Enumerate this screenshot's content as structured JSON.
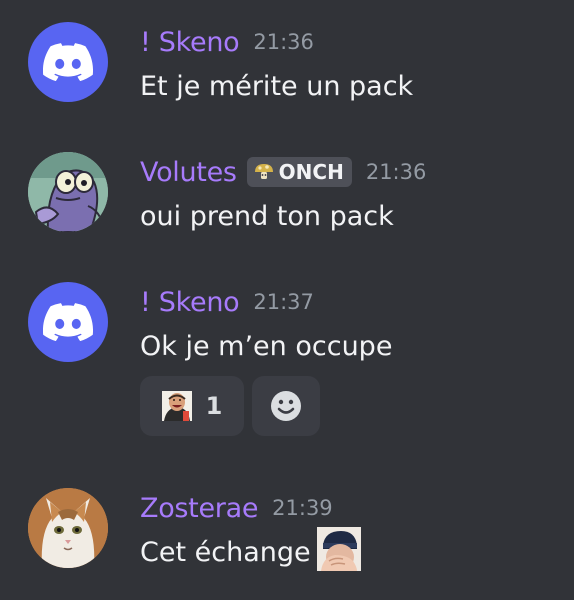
{
  "messages": [
    {
      "username": "! Skeno",
      "timestamp": "21:36",
      "content": "Et je mérite un pack",
      "avatar": "discord-default-avatar"
    },
    {
      "username": "Volutes",
      "tag": "ONCH",
      "timestamp": "21:36",
      "content": "oui prend ton pack",
      "avatar": "cartoon-fish-avatar"
    },
    {
      "username": "! Skeno",
      "timestamp": "21:37",
      "content": "Ok je m’en occupe",
      "avatar": "discord-default-avatar",
      "reactions": [
        {
          "emoji": "laughing-man-emoji",
          "count": "1"
        },
        {
          "emoji": "add-reaction-smiley-icon"
        }
      ]
    },
    {
      "username": "Zosterae",
      "timestamp": "21:39",
      "content": "Cet échange",
      "avatar": "kitten-avatar",
      "inline_emoji": "facepalm-emoji"
    }
  ],
  "colors": {
    "background": "#313338",
    "username": "#a77bfb",
    "timestamp": "#949ba4",
    "text": "#f2f3f5",
    "discord_blurple": "#5865f2",
    "reaction_bg": "#3b3d44",
    "tag_bg": "#4e5058"
  }
}
